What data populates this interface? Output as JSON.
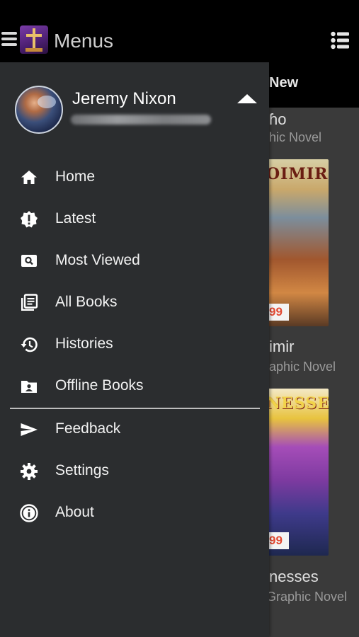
{
  "appbar": {
    "title": "Menus",
    "menu_icon": "hamburger-icon",
    "logo_icon": "sword-cross-logo",
    "right_icon": "list-view-icon"
  },
  "content": {
    "tab_label": "New",
    "books": [
      {
        "title_fragment": "ɦo",
        "subtitle_fragment": "hic Novel"
      },
      {
        "cover_text": "OIMIR",
        "price_fragment": "99",
        "title_fragment": "imir",
        "subtitle_fragment": "aphic Novel"
      },
      {
        "cover_text": "NESSES",
        "price_fragment": "99",
        "title_fragment": "nesses",
        "subtitle_fragment": "Graphic Novel"
      }
    ]
  },
  "drawer": {
    "user": {
      "name": "Jeremy Nixon",
      "email_redacted": true
    },
    "items": [
      {
        "label": "Home",
        "icon": "home-icon"
      },
      {
        "label": "Latest",
        "icon": "alert-badge-icon"
      },
      {
        "label": "Most Viewed",
        "icon": "search-box-icon"
      },
      {
        "label": "All Books",
        "icon": "library-icon"
      },
      {
        "label": "Histories",
        "icon": "history-icon"
      },
      {
        "label": "Offline Books",
        "icon": "offline-folder-icon"
      },
      {
        "label": "Feedback",
        "icon": "send-icon"
      },
      {
        "label": "Settings",
        "icon": "gear-icon"
      },
      {
        "label": "About",
        "icon": "info-icon"
      }
    ]
  },
  "colors": {
    "drawer_bg": "#2b2d2f",
    "appbar_bg": "#000000",
    "content_bg": "#3a3a3a",
    "price_red": "#e24a33"
  }
}
